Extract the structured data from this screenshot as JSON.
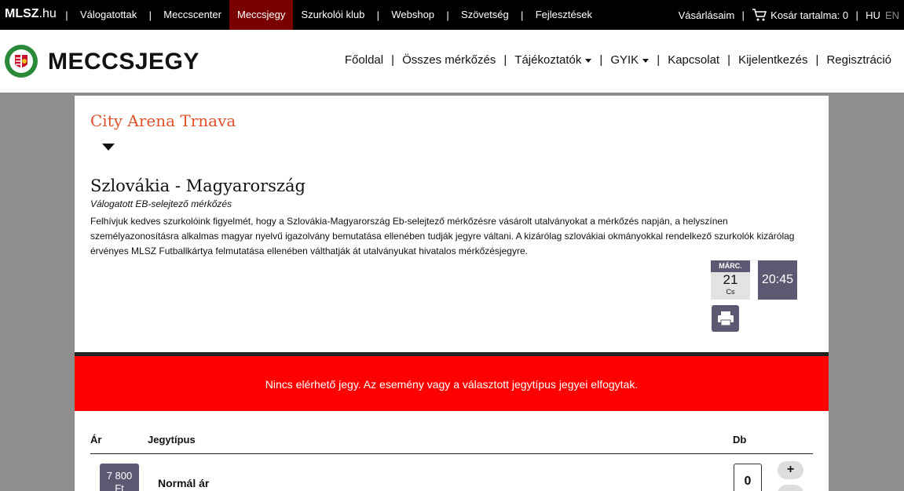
{
  "topbar": {
    "brand_bold": "MLSZ",
    "brand_rest": ".hu",
    "nav": [
      {
        "label": "Válogatottak",
        "active": false
      },
      {
        "label": "Meccscenter",
        "active": false
      },
      {
        "label": "Meccsjegy",
        "active": true
      },
      {
        "label": "Szurkolói klub",
        "active": false
      },
      {
        "label": "Webshop",
        "active": false
      },
      {
        "label": "Szövetség",
        "active": false
      },
      {
        "label": "Fejlesztések",
        "active": false
      }
    ],
    "purchases": "Vásárlásaim",
    "cart": "Kosár tartalma: 0",
    "lang_hu": "HU",
    "lang_en": "EN",
    "active_color": "#7a0000"
  },
  "header": {
    "logo_text": "MECCSJEGY",
    "nav": [
      {
        "label": "Főoldal",
        "dropdown": false
      },
      {
        "label": "Összes mérkőzés",
        "dropdown": false
      },
      {
        "label": "Tájékoztatók",
        "dropdown": true
      },
      {
        "label": "GYIK",
        "dropdown": true
      },
      {
        "label": "Kapcsolat",
        "dropdown": false
      },
      {
        "label": "Kijelentkezés",
        "dropdown": false
      },
      {
        "label": "Regisztráció",
        "dropdown": false
      }
    ]
  },
  "event": {
    "venue": "City Arena Trnava",
    "title": "Szlovákia - Magyarország",
    "subtitle": "Válogatott EB-selejtező mérkőzés",
    "notice": "Felhívjuk kedves szurkolóink figyelmét, hogy a Szlovákia-Magyarország Eb-selejtező mérkőzésre vásárolt utalványokat a mérkőzés napján, a helyszínen személyazonosításra alkalmas magyar nyelvű igazolvány bemutatása ellenében tudják jegyre váltani. A kizárólag szlovákiai okmányokkal rendelkező szurkolók kizárólag érvényes MLSZ Futballkártya felmutatása ellenében válthatják át utalványukat hivatalos mérkőzésjegyre.",
    "date_month": "MÁRC.",
    "date_day": "21",
    "date_dow": "Cs",
    "time": "20:45",
    "accent_color": "#e0502a",
    "box_color": "#5c5a72"
  },
  "alert": {
    "text": "Nincs elérhető jegy. Az esemény vagy a választott jegytípus jegyei elfogytak.",
    "color": "#fe0000"
  },
  "tickets": {
    "headers": {
      "price": "Ár",
      "type": "Jegytípus",
      "qty": "Db"
    },
    "rows": [
      {
        "price_line1": "7 800",
        "price_line2": "Ft",
        "name": "Normál ár",
        "qty": "0"
      }
    ],
    "plus_label": "+"
  }
}
